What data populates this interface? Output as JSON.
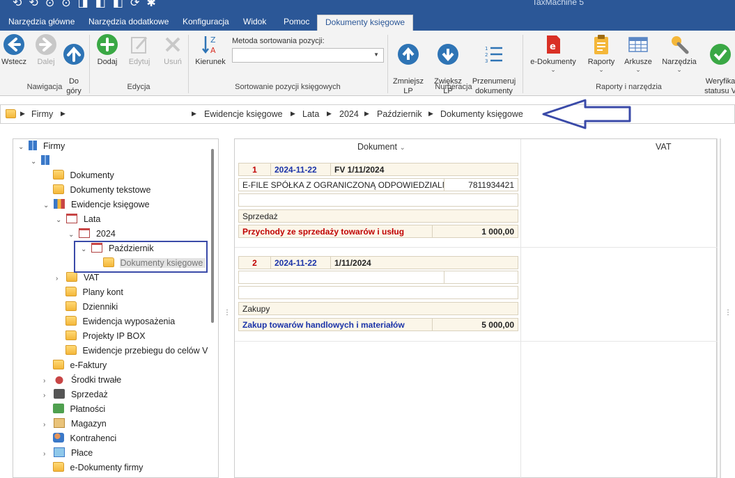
{
  "window": {
    "title": "TaxMachine 5"
  },
  "tabs": [
    {
      "label": "Narzędzia główne",
      "active": false
    },
    {
      "label": "Narzędzia dodatkowe",
      "active": false
    },
    {
      "label": "Konfiguracja",
      "active": false
    },
    {
      "label": "Widok",
      "active": false
    },
    {
      "label": "Pomoc",
      "active": false
    },
    {
      "label": "Dokumenty księgowe",
      "active": true
    }
  ],
  "ribbon": {
    "groups": {
      "navigation": "Nawigacja",
      "edit": "Edycja",
      "sort": "Sortowanie pozycji księgowych",
      "numbering": "Numeracja",
      "reports": "Raporty i narzędzia"
    },
    "buttons": {
      "back": "Wstecz",
      "next": "Dalej",
      "up": "Do\ngóry",
      "add": "Dodaj",
      "edit": "Edytuj",
      "delete": "Usuń",
      "direction": "Kierunek",
      "decrease": "Zmniejsz\nLP",
      "increase": "Zwiększ\nLP",
      "renumber": "Przenumeruj\ndokumenty",
      "edocs": "e-Dokumenty",
      "reports": "Raporty",
      "sheets": "Arkusze",
      "tools": "Narzędzia",
      "verify": "Weryfika\nstatusu V"
    },
    "sort_label": "Metoda sortowania pozycji:",
    "sort_value": ""
  },
  "breadcrumb": [
    "Firmy",
    "Ewidencje księgowe",
    "Lata",
    "2024",
    "Październik",
    "Dokumenty księgowe"
  ],
  "tree": {
    "root": "Firmy",
    "items": {
      "dokumenty": "Dokumenty",
      "dok_tekstowe": "Dokumenty tekstowe",
      "ewidencje": "Ewidencje księgowe",
      "lata": "Lata",
      "rok": "2024",
      "miesiac": "Październik",
      "dok_ksiegowe": "Dokumenty księgowe",
      "vat": "VAT",
      "plany": "Plany kont",
      "dzienniki": "Dzienniki",
      "wyposazenie": "Ewidencja wyposażenia",
      "ipbox": "Projekty IP BOX",
      "przebieg": "Ewidencje przebiegu do celów V",
      "efaktury": "e-Faktury",
      "srodki": "Środki trwałe",
      "sprzedaz": "Sprzedaż",
      "platnosci": "Płatności",
      "magazyn": "Magazyn",
      "kontrahenci": "Kontrahenci",
      "place": "Płace",
      "edok_firmy": "e-Dokumenty firmy"
    }
  },
  "grid": {
    "columns": {
      "document": "Dokument",
      "vat": "VAT"
    },
    "documents": [
      {
        "lp": "1",
        "date": "2024-11-22",
        "number": "FV 1/11/2024",
        "contractor": "E-FILE SPÓŁKA Z OGRANICZONĄ ODPOWIEDZIALN",
        "nip": "7811934421",
        "type": "Sprzedaż",
        "account": "Przychody ze sprzedaży towarów i usług",
        "amount": "1 000,00"
      },
      {
        "lp": "2",
        "date": "2024-11-22",
        "number": "1/11/2024",
        "contractor": "",
        "nip": "",
        "type": "Zakupy",
        "account": "Zakup towarów handlowych i materiałów",
        "amount": "5 000,00"
      }
    ]
  },
  "colors": {
    "accent": "#2b5797",
    "red": "#c00000",
    "blue": "#1b33a8",
    "annotation": "#3a4aa8"
  }
}
